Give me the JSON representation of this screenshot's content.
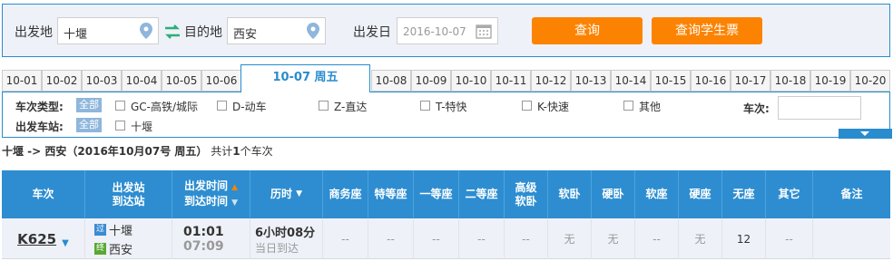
{
  "search": {
    "from_label": "出发地",
    "from_value": "十堰",
    "to_label": "目的地",
    "to_value": "西安",
    "date_label": "出发日",
    "date_value": "2016-10-07",
    "query_button": "查询",
    "student_button": "查询学生票"
  },
  "date_tabs": {
    "before": [
      "10-01",
      "10-02",
      "10-03",
      "10-04",
      "10-05",
      "10-06"
    ],
    "active": "10-07 周五",
    "after": [
      "10-08",
      "10-09",
      "10-10",
      "10-11",
      "10-12",
      "10-13",
      "10-14",
      "10-15",
      "10-16",
      "10-17",
      "10-18",
      "10-19",
      "10-20"
    ]
  },
  "filters": {
    "train_type_label": "车次类型:",
    "all_label": "全部",
    "types": [
      "GC-高铁/城际",
      "D-动车",
      "Z-直达",
      "T-特快",
      "K-快速",
      "其他"
    ],
    "station_label": "出发车站:",
    "stations": [
      "十堰"
    ],
    "train_number_label": "车次:"
  },
  "summary": {
    "route": "十堰 -> 西安（2016年10月07号  周五）",
    "count_prefix": "共计",
    "count": "1",
    "count_suffix": "个车次"
  },
  "table": {
    "headers": {
      "train": "车次",
      "station_1": "出发站",
      "station_2": "到达站",
      "time_1": "出发时间",
      "time_2": "到达时间",
      "duration": "历时",
      "business": "商务座",
      "special": "特等座",
      "first": "一等座",
      "second": "二等座",
      "premium_1": "高级",
      "premium_2": "软卧",
      "soft_sleeper": "软卧",
      "hard_sleeper": "硬卧",
      "soft_seat": "软座",
      "hard_seat": "硬座",
      "no_seat": "无座",
      "other": "其它",
      "remark": "备注"
    },
    "rows": [
      {
        "train": "K625",
        "from_badge": "过",
        "from": "十堰",
        "to_badge": "终",
        "to": "西安",
        "depart": "01:01",
        "arrive": "07:09",
        "duration": "6小时08分",
        "arrival_day": "当日到达",
        "business": "--",
        "special": "--",
        "first": "--",
        "second": "--",
        "premium": "--",
        "soft_sleeper": "无",
        "hard_sleeper": "无",
        "soft_seat": "--",
        "hard_seat": "无",
        "no_seat": "12",
        "other": "--",
        "remark": ""
      }
    ]
  },
  "colors": {
    "accent_blue": "#298cce",
    "header_blue": "#2d8dd0",
    "orange_button": "#fc8302",
    "pass_badge": "#3b8bd3",
    "terminal_badge": "#5aa832"
  }
}
